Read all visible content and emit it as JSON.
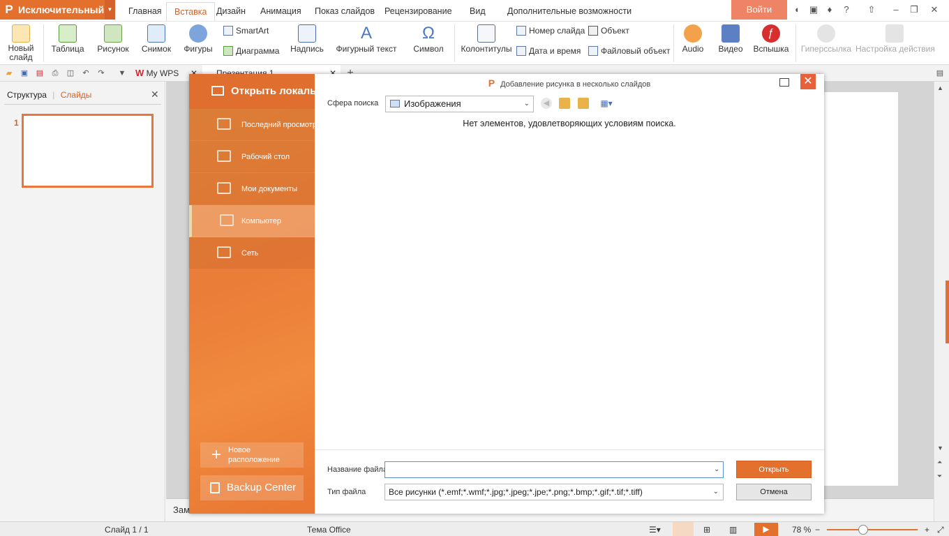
{
  "app": {
    "menu_label": "Исключительный",
    "login": "Войти"
  },
  "tabs": [
    "Главная",
    "Вставка",
    "Дизайн",
    "Анимация",
    "Показ слайдов",
    "Рецензирование",
    "Вид",
    "Дополнительные возможности"
  ],
  "ribbon": {
    "new_slide": "Новый слайд",
    "table": "Таблица",
    "picture": "Рисунок",
    "screenshot": "Снимок",
    "shapes": "Фигуры",
    "smartart": "SmartArt",
    "diagram": "Диаграмма",
    "textbox": "Надпись",
    "wordart": "Фигурный текст",
    "symbol": "Символ",
    "header_footer": "Колонтитулы",
    "slide_number": "Номер слайда",
    "date_time": "Дата и время",
    "object": "Объект",
    "file_object": "Файловый объект",
    "audio": "Audio",
    "video": "Видео",
    "flash": "Вспышка",
    "hyperlink": "Гиперссылка",
    "action": "Настройка действия"
  },
  "doc_tabs": {
    "wps": "My WPS",
    "presentation": "Презентация 1"
  },
  "left_pane": {
    "tab_structure": "Структура",
    "tab_slides": "Слайды",
    "slide_number": "1"
  },
  "notes": "Зам",
  "status": {
    "slide": "Слайд 1 / 1",
    "theme": "Тема Office",
    "zoom": "78 %"
  },
  "dialog": {
    "title": "Добавление рисунка в несколько слайдов",
    "side_header": "Открыть локальный",
    "nav": [
      "Последний просмотр",
      "Рабочий стол",
      "Мои документы",
      "Компьютер",
      "Сеть"
    ],
    "new_location": "Новое расположение",
    "backup_center": "Backup Center",
    "scope_label": "Сфера поиска",
    "scope_value": "Изображения",
    "empty_message": "Нет элементов, удовлетворяющих условиям поиска.",
    "filename_label": "Название файла",
    "filename_value": "",
    "filetype_label": "Тип файла",
    "filetype_value": "Все рисунки (*.emf;*.wmf;*.jpg;*.jpeg;*.jpe;*.png;*.bmp;*.gif;*.tif;*.tiff)",
    "open_button": "Открыть",
    "cancel_button": "Отмена"
  },
  "colors": {
    "accent": "#e4702e",
    "login": "#ef8365",
    "close": "#e8603b"
  }
}
